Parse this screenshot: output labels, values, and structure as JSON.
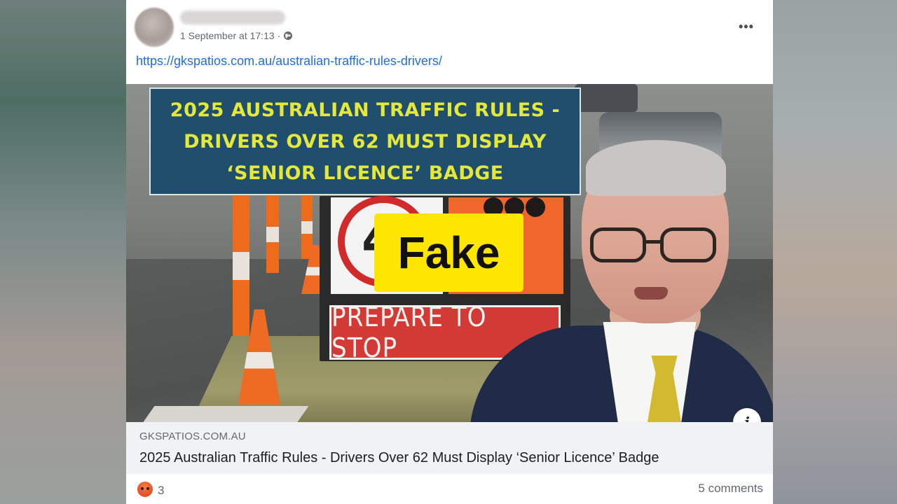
{
  "post": {
    "author_name": "",
    "timestamp": "1 September at 17:13",
    "separator": "·",
    "privacy_icon": "globe-icon",
    "more_icon": "•••",
    "link_url": "https://gkspatios.com.au/australian-traffic-rules-drivers/"
  },
  "preview_image": {
    "headline_lines": [
      "2025 AUSTRALIAN TRAFFIC RULES -",
      "DRIVERS OVER 62 MUST DISPLAY",
      "‘SENIOR LICENCE’ BADGE"
    ],
    "sign_text": "PREPARE TO STOP",
    "speed_digit": "4",
    "fake_label": "Fake",
    "info_icon": "i"
  },
  "link_card": {
    "domain": "GKSPATIOS.COM.AU",
    "title": "2025 Australian Traffic Rules - Drivers Over 62 Must Display ‘Senior Licence’ Badge"
  },
  "footer": {
    "reaction_icon": "angry-reaction-icon",
    "reaction_count": "3",
    "comments": "5 comments"
  },
  "colors": {
    "link": "#216fdb",
    "headline_bg": "#1f4f6c",
    "headline_text": "#e4e83c",
    "fake_bg": "#ffe601"
  }
}
